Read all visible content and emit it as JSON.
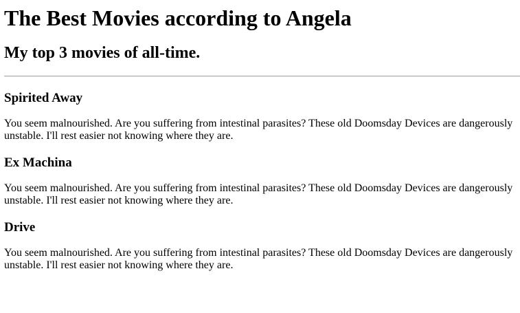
{
  "page": {
    "title": "The Best Movies according to Angela",
    "subtitle": "My top 3 movies of all-time."
  },
  "movies": [
    {
      "title": "Spirited Away",
      "description": "You seem malnourished. Are you suffering from intestinal parasites? These old Doomsday Devices are dangerously unstable. I'll rest easier not knowing where they are."
    },
    {
      "title": "Ex Machina",
      "description": "You seem malnourished. Are you suffering from intestinal parasites? These old Doomsday Devices are dangerously unstable. I'll rest easier not knowing where they are."
    },
    {
      "title": "Drive",
      "description": "You seem malnourished. Are you suffering from intestinal parasites? These old Doomsday Devices are dangerously unstable. I'll rest easier not knowing where they are."
    }
  ]
}
